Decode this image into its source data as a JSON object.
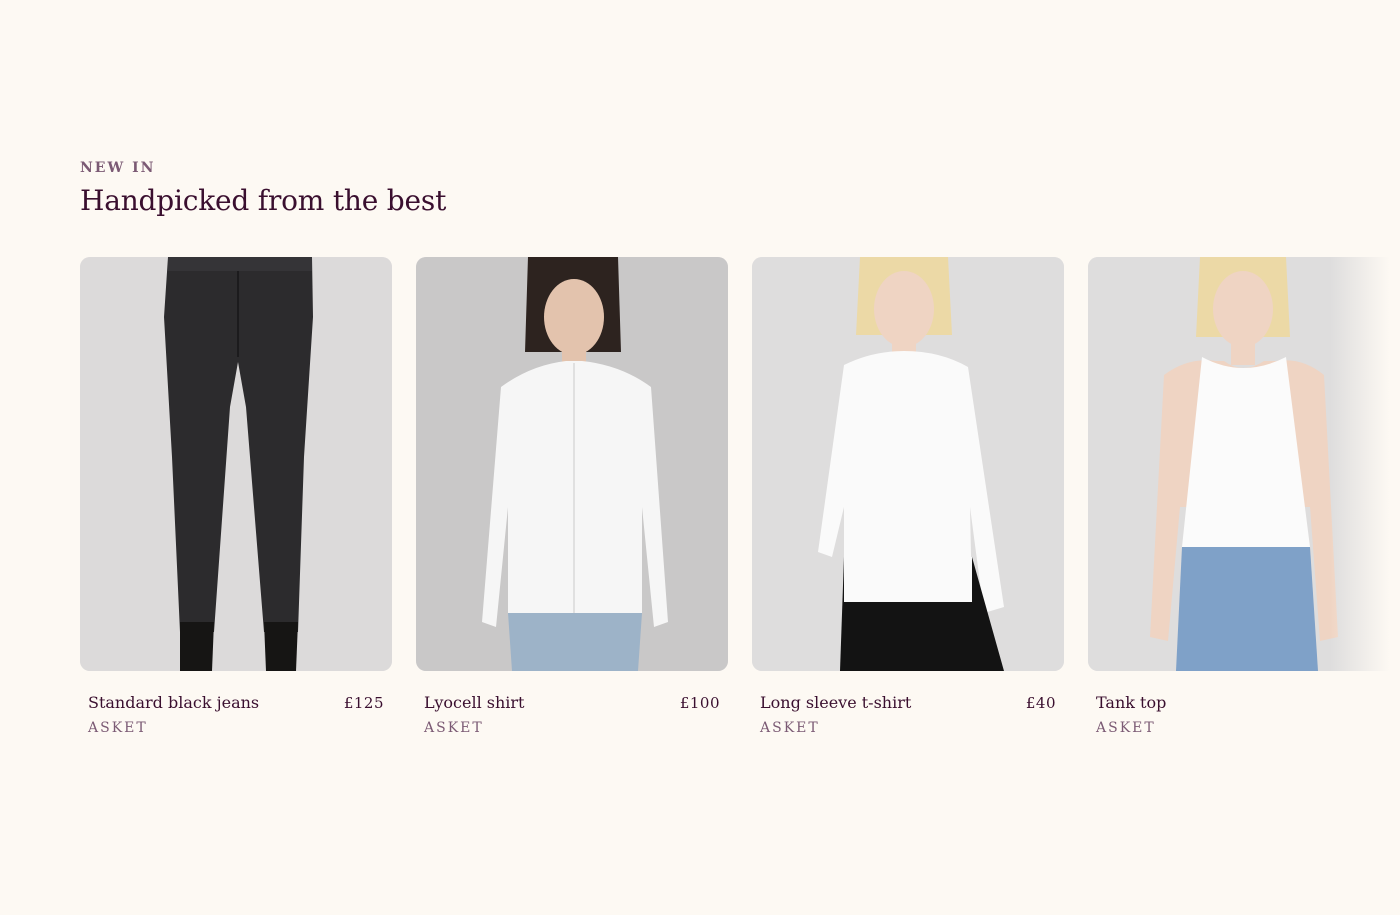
{
  "section": {
    "eyebrow": "NEW IN",
    "heading": "Handpicked from the best"
  },
  "products": [
    {
      "title": "Standard black jeans",
      "price": "£125",
      "brand": "ASKET",
      "image": "black-jeans-photo"
    },
    {
      "title": "Lyocell shirt",
      "price": "£100",
      "brand": "ASKET",
      "image": "white-shirt-photo"
    },
    {
      "title": "Long sleeve t-shirt",
      "price": "£40",
      "brand": "ASKET",
      "image": "long-sleeve-tshirt-photo"
    },
    {
      "title": "Tank top",
      "price": "",
      "brand": "ASKET",
      "image": "tank-top-photo"
    }
  ],
  "colors": {
    "background": "#fdf9f3",
    "heading": "#3a0f2f",
    "muted": "#7b5a74"
  }
}
